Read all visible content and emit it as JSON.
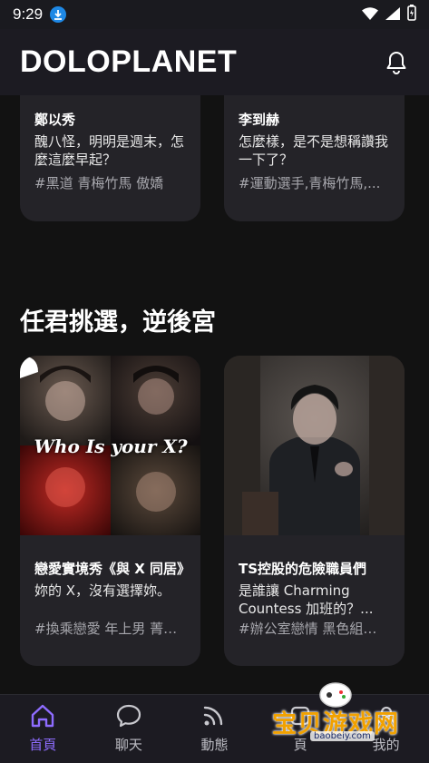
{
  "status_bar": {
    "time": "9:29"
  },
  "header": {
    "brand": "DOLOPLANET"
  },
  "top_cards": [
    {
      "title": "鄭以秀",
      "desc": "醜八怪，明明是週末，怎麼這麼早起？",
      "tags": "#黑道 青梅竹馬 傲嬌"
    },
    {
      "title": "李到赫",
      "desc": "怎麼樣，是不是想稱讚我一下了？",
      "tags": "#運動選手,青梅竹馬,..."
    }
  ],
  "section": {
    "title": "任君挑選，逆後宮"
  },
  "story_cards": [
    {
      "image_caption": "Who Is your X?",
      "title": "戀愛實境秀《與 X 同居》",
      "desc": "妳的 X，沒有選擇妳。",
      "tags": "#換乘戀愛 年上男 菁…"
    },
    {
      "title": "TS控股的危險職員們",
      "desc": "是誰讓 Charming Countess 加班的？...",
      "tags": "#辦公室戀情 黑色組…"
    }
  ],
  "bottom_nav": [
    {
      "label": "首頁",
      "icon": "home-icon",
      "active": true
    },
    {
      "label": "聊天",
      "icon": "chat-bubble-icon",
      "active": false
    },
    {
      "label": "動態",
      "icon": "feed-icon",
      "active": false
    },
    {
      "label": "頁",
      "icon": "badge-icon",
      "active": false
    },
    {
      "label": "我的",
      "icon": "profile-icon",
      "active": false
    }
  ],
  "watermark": {
    "text": "宝贝游戏网",
    "url": "baobeiy.com"
  },
  "colors": {
    "accent": "#8e6cff",
    "background": "#121212",
    "card": "#242328",
    "header": "#1c1b22",
    "watermark": "#f1a100"
  }
}
